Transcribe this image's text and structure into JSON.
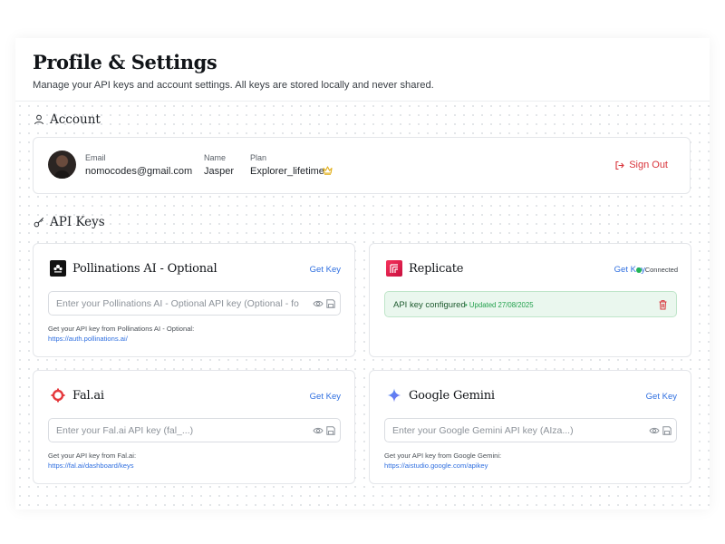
{
  "page": {
    "title": "Profile & Settings",
    "subtitle": "Manage your API keys and account settings. All keys are stored locally and never shared."
  },
  "account": {
    "section_title": "Account",
    "email_label": "Email",
    "email": "nomocodes@gmail.com",
    "name_label": "Name",
    "name": "Jasper",
    "plan_label": "Plan",
    "plan": "Explorer_lifetime",
    "plan_icon": "crown-icon",
    "sign_out": "Sign Out"
  },
  "api_keys": {
    "section_title": "API Keys",
    "providers": [
      {
        "name": "Pollinations AI - Optional",
        "get_key": "Get Key",
        "placeholder": "Enter your Pollinations AI - Optional API key (Optional - fo",
        "help": "Get your API key from Pollinations AI - Optional:",
        "link": "https://auth.pollinations.ai/",
        "logo_color": "#111111"
      },
      {
        "name": "Replicate",
        "get_key": "Get Key",
        "status": "Connected",
        "configured_text": "API key configured",
        "updated_text": "• Updated 27/08/2025",
        "logo_color": "#e8184f"
      },
      {
        "name": "Fal.ai",
        "get_key": "Get Key",
        "placeholder": "Enter your Fal.ai API key (fal_...)",
        "help": "Get your API key from Fal.ai:",
        "link": "https://fal.ai/dashboard/keys",
        "logo_color": "#e5393d"
      },
      {
        "name": "Google Gemini",
        "get_key": "Get Key",
        "placeholder": "Enter your Google Gemini API key (AIza...)",
        "help": "Get your API key from Google Gemini:",
        "link": "https://aistudio.google.com/apikey",
        "logo_color": "#4b8df3"
      }
    ]
  },
  "colors": {
    "accent_link": "#2f6fe0",
    "danger": "#d9343b",
    "success": "#22b557"
  }
}
